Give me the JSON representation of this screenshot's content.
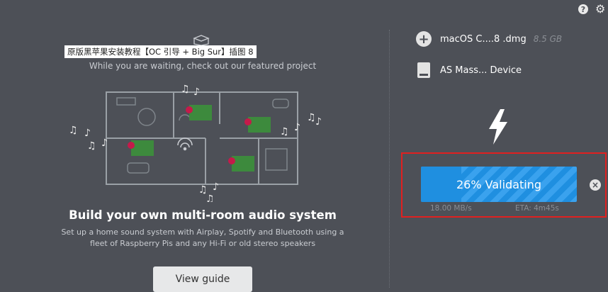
{
  "header": {
    "help_icon": "question-circle-icon",
    "settings_icon": "gear-icon"
  },
  "left_panel": {
    "watermark": "原版黑苹果安装教程【OC 引导 + Big Sur】插图 8",
    "waiting_text": "While you are waiting, check out our featured project",
    "headline": "Build your own multi-room audio system",
    "description_line1": "Set up a home sound system with Airplay, Spotify and Bluetooth using a",
    "description_line2": "fleet of Raspberry Pis and any Hi-Fi or old stereo speakers",
    "guide_button": "View guide"
  },
  "right_panel": {
    "image": {
      "name": "macOS C....8 .dmg",
      "size": "8.5 GB",
      "icon": "plus-circle-icon"
    },
    "drive": {
      "name": "AS Mass... Device",
      "icon": "drive-icon"
    },
    "flash_icon": "lightning-bolt-icon",
    "progress": {
      "label": "26% Validating",
      "percent": 26,
      "speed": "18.00 MB/s",
      "eta": "ETA: 4m45s"
    },
    "cancel_icon": "close-circle-icon"
  },
  "colors": {
    "background": "#4d5057",
    "progress_blue": "#1f8fe0",
    "highlight_red": "#e02020"
  }
}
